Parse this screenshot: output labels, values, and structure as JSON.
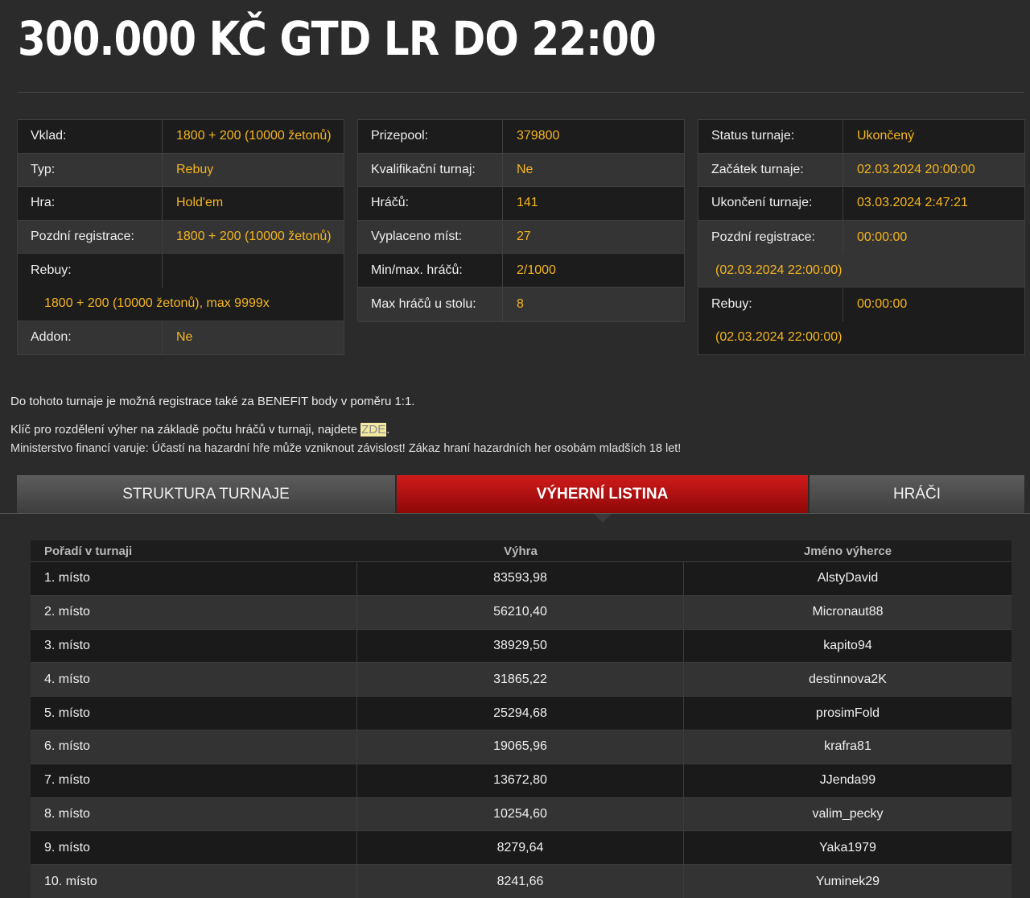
{
  "title": "300.000 KČ GTD LR DO 22:00",
  "info_left": [
    {
      "label": "Vklad:",
      "value": "1800 + 200 (10000 žetonů)"
    },
    {
      "label": "Typ:",
      "value": "Rebuy"
    },
    {
      "label": "Hra:",
      "value": "Hold'em"
    },
    {
      "label": "Pozdní registrace:",
      "value": "1800 + 200 (10000 žetonů)"
    },
    {
      "label": "Rebuy:",
      "value": ""
    },
    {
      "label": "",
      "value": "1800 + 200 (10000 žetonů), max 9999x"
    },
    {
      "label": "Addon:",
      "value": "Ne"
    }
  ],
  "info_middle": [
    {
      "label": "Prizepool:",
      "value": "379800"
    },
    {
      "label": "Kvalifikační turnaj:",
      "value": "Ne"
    },
    {
      "label": "Hráčů:",
      "value": "141"
    },
    {
      "label": "Vyplaceno míst:",
      "value": "27"
    },
    {
      "label": "Min/max. hráčů:",
      "value": "2/1000"
    },
    {
      "label": "Max hráčů u stolu:",
      "value": "8"
    }
  ],
  "info_right": [
    {
      "label": "Status turnaje:",
      "value": "Ukončený"
    },
    {
      "label": "Začátek turnaje:",
      "value": "02.03.2024 20:00:00"
    },
    {
      "label": "Ukončení turnaje:",
      "value": "03.03.2024 2:47:21"
    },
    {
      "label": "Pozdní registrace:",
      "value": "00:00:00"
    },
    {
      "label": "",
      "value": "(02.03.2024 22:00:00)"
    },
    {
      "label": "Rebuy:",
      "value": "00:00:00"
    },
    {
      "label": "",
      "value": "(02.03.2024 22:00:00)"
    }
  ],
  "notes": {
    "benefit": "Do tohoto turnaje je možná registrace také za BENEFIT body v poměru 1:1.",
    "key_prefix": "Klíč pro rozdělení výher na základě počtu hráčů v turnaji, najdete ",
    "key_link": "ZDE",
    "key_suffix": ".",
    "warning": "Ministerstvo financí varuje: Účastí na hazardní hře může vzniknout závislost! Zákaz hraní hazardních her osobám mladších 18 let!"
  },
  "tabs": [
    {
      "label": "STRUKTURA TURNAJE",
      "active": false
    },
    {
      "label": "VÝHERNÍ LISTINA",
      "active": true
    },
    {
      "label": "HRÁČI",
      "active": false
    }
  ],
  "results": {
    "headers": [
      "Pořadí v turnaji",
      "Výhra",
      "Jméno výherce"
    ],
    "rows": [
      [
        "1. místo",
        "83593,98",
        "AlstyDavid"
      ],
      [
        "2. místo",
        "56210,40",
        "Micronaut88"
      ],
      [
        "3. místo",
        "38929,50",
        "kapito94"
      ],
      [
        "4. místo",
        "31865,22",
        "destinnova2K"
      ],
      [
        "5. místo",
        "25294,68",
        "prosimFold"
      ],
      [
        "6. místo",
        "19065,96",
        "krafra81"
      ],
      [
        "7. místo",
        "13672,80",
        "JJenda99"
      ],
      [
        "8. místo",
        "10254,60",
        "valim_pecky"
      ],
      [
        "9. místo",
        "8279,64",
        "Yaka1979"
      ],
      [
        "10. místo",
        "8241,66",
        "Yuminek29"
      ]
    ]
  },
  "colors": {
    "accent": "#f5b51e",
    "active_tab": "#c41414",
    "background": "#2b2b2b"
  }
}
